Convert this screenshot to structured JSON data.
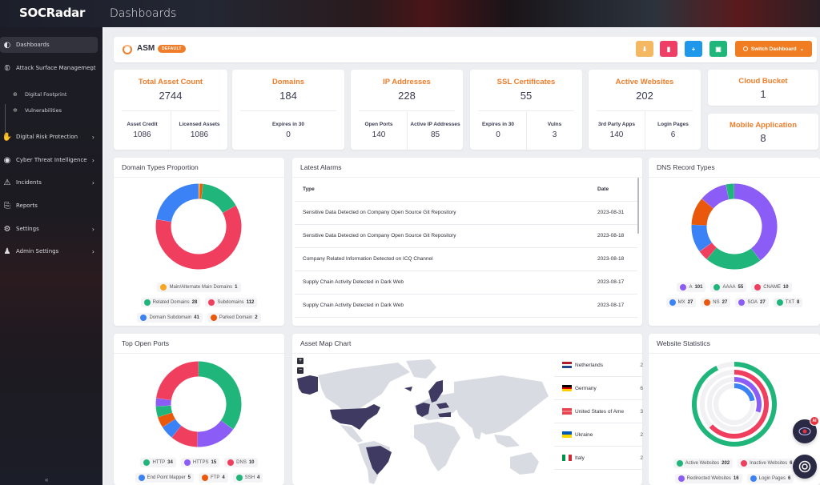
{
  "app": {
    "brand": "SOCRadar",
    "page_title": "Dashboards"
  },
  "sidebar": {
    "items": [
      {
        "label": "Dashboards",
        "icon": "dashboard-icon",
        "active": true
      },
      {
        "label": "Attack Surface Management",
        "icon": "asm-icon",
        "expanded": true
      },
      {
        "label": "Digital Risk Protection",
        "icon": "hand-shield-icon"
      },
      {
        "label": "Cyber Threat Intelligence",
        "icon": "eye-shield-icon"
      },
      {
        "label": "Incidents",
        "icon": "incident-icon"
      },
      {
        "label": "Reports",
        "icon": "report-icon"
      },
      {
        "label": "Settings",
        "icon": "gear-icon"
      },
      {
        "label": "Admin Settings",
        "icon": "admin-icon"
      }
    ],
    "subitems": [
      {
        "label": "Digital Footprint",
        "icon": "globe-icon"
      },
      {
        "label": "Vulnerabilities",
        "icon": "bug-icon"
      }
    ],
    "collapse_glyph": "«"
  },
  "header": {
    "title": "ASM",
    "badge": "DEFAULT",
    "buttons": [
      {
        "name": "pin-button",
        "glyph": "⬇",
        "color": "#f5b862"
      },
      {
        "name": "delete-button",
        "glyph": "▮",
        "color": "#ef3e66"
      },
      {
        "name": "add-button",
        "glyph": "+",
        "color": "#1f97ea"
      },
      {
        "name": "save-button",
        "glyph": "▣",
        "color": "#20b57b"
      }
    ],
    "switch_label": "Switch Dashboard",
    "switch_chevron": "⌄",
    "accent": "#f07d2a"
  },
  "stats": {
    "total": {
      "title": "Total Asset Count",
      "value": "2744",
      "subs": [
        {
          "label": "Asset Credit",
          "value": "1086"
        },
        {
          "label": "Licensed Assets",
          "value": "1086"
        }
      ]
    },
    "domains": {
      "title": "Domains",
      "value": "184",
      "subs": [
        {
          "label": "Expires in 30",
          "value": "0"
        }
      ]
    },
    "ip": {
      "title": "IP Addresses",
      "value": "228",
      "subs": [
        {
          "label": "Open Ports",
          "value": "140"
        },
        {
          "label": "Active IP Addresses",
          "value": "85"
        }
      ]
    },
    "ssl": {
      "title": "SSL Certificates",
      "value": "55",
      "subs": [
        {
          "label": "Expires in 30",
          "value": "0"
        },
        {
          "label": "Vulns",
          "value": "3"
        }
      ]
    },
    "web": {
      "title": "Active Websites",
      "value": "202",
      "subs": [
        {
          "label": "3rd Party Apps",
          "value": "140"
        },
        {
          "label": "Login Pages",
          "value": "6"
        }
      ]
    },
    "cloud": {
      "title": "Cloud Bucket",
      "value": "1"
    },
    "mobile": {
      "title": "Mobile Application",
      "value": "8"
    }
  },
  "domain_types": {
    "title": "Domain Types Proportion",
    "slices": [
      {
        "label": "Main/Alternate Main Domains",
        "value": 1,
        "color": "#f5a623"
      },
      {
        "label": "Related Domains",
        "value": 28,
        "color": "#20b57b"
      },
      {
        "label": "Subdomains",
        "value": 112,
        "color": "#f03e5e"
      },
      {
        "label": "Domain Subdomain",
        "value": 41,
        "color": "#3b82f6"
      },
      {
        "label": "Parked Domain",
        "value": 2,
        "color": "#ea580c"
      }
    ],
    "order": [
      0,
      4,
      1,
      2,
      3
    ]
  },
  "alarms": {
    "title": "Latest Alarms",
    "columns": [
      "Type",
      "Date"
    ],
    "rows": [
      [
        "Sensitive Data Detected on Company Open Source Git Repository",
        "2023-08-31"
      ],
      [
        "Sensitive Data Detected on Company Open Source Git Repository",
        "2023-08-18"
      ],
      [
        "Company Related Information Detected on ICQ Channel",
        "2023-08-18"
      ],
      [
        "Supply Chain Activity Detected in Dark Web",
        "2023-08-17"
      ],
      [
        "Supply Chain Activity Detected in Dark Web",
        "2023-08-17"
      ]
    ]
  },
  "dns": {
    "title": "DNS Record Types",
    "slices": [
      {
        "label": "A",
        "value": 101,
        "color": "#8b5cf6"
      },
      {
        "label": "AAAA",
        "value": 55,
        "color": "#20b57b"
      },
      {
        "label": "CNAME",
        "value": 10,
        "color": "#f03e5e"
      },
      {
        "label": "MX",
        "value": 27,
        "color": "#3b82f6"
      },
      {
        "label": "NS",
        "value": 27,
        "color": "#ea580c"
      },
      {
        "label": "SOA",
        "value": 27,
        "color": "#8b5cf6"
      },
      {
        "label": "TXT",
        "value": 8,
        "color": "#20b57b"
      }
    ]
  },
  "ports": {
    "title": "Top Open Ports",
    "slices": [
      {
        "label": "HTTP",
        "value": 34,
        "color": "#20b57b"
      },
      {
        "label": "HTTPS",
        "value": 15,
        "color": "#8b5cf6"
      },
      {
        "label": "DNS",
        "value": 10,
        "color": "#f03e5e"
      },
      {
        "label": "End Point Mapper",
        "value": 5,
        "color": "#3b82f6"
      },
      {
        "label": "FTP",
        "value": 4,
        "color": "#ea580c"
      },
      {
        "label": "SSH",
        "value": 4,
        "color": "#20b57b"
      },
      {
        "label": "Other",
        "value": 3,
        "color": "#8b5cf6",
        "hidden": true
      },
      {
        "label": "Other2",
        "value": 22,
        "color": "#f03e5e",
        "hidden": true
      }
    ]
  },
  "map": {
    "title": "Asset Map Chart",
    "zoom_in": "+",
    "zoom_out": "−",
    "highlight_color": "#3f3a62",
    "land_color": "#d9dbe2",
    "countries": [
      {
        "name": "Netherlands",
        "count": "2",
        "flag": [
          "#ae1c28",
          "#ffffff",
          "#21468b"
        ],
        "dir": "h"
      },
      {
        "name": "Germany",
        "count": "6",
        "flag": [
          "#000000",
          "#dd0000",
          "#ffce00"
        ],
        "dir": "h"
      },
      {
        "name": "United States of Ame",
        "count": "3",
        "flag": [
          "#e8434f",
          "#f07a82",
          "#e8434f"
        ],
        "dir": "h"
      },
      {
        "name": "Ukraine",
        "count": "2",
        "flag": [
          "#0057b7",
          "#ffd700"
        ],
        "dir": "h"
      },
      {
        "name": "Italy",
        "count": "2",
        "flag": [
          "#009246",
          "#ffffff",
          "#ce2b37"
        ],
        "dir": "v"
      }
    ]
  },
  "website_stats": {
    "title": "Website Statistics",
    "series": [
      {
        "label": "Active Websites",
        "value": 202,
        "fraction": 0.93,
        "color": "#20b57b"
      },
      {
        "label": "Inactive Websites",
        "value": "6",
        "fraction": 0.63,
        "color": "#f03e5e"
      },
      {
        "label": "Redirected Websites",
        "value": 16,
        "fraction": 0.3,
        "color": "#8b5cf6"
      },
      {
        "label": "Login Pages",
        "value": 6,
        "fraction": 0.22,
        "color": "#3b82f6"
      }
    ]
  },
  "fab": {
    "ai_badge": "AI"
  }
}
